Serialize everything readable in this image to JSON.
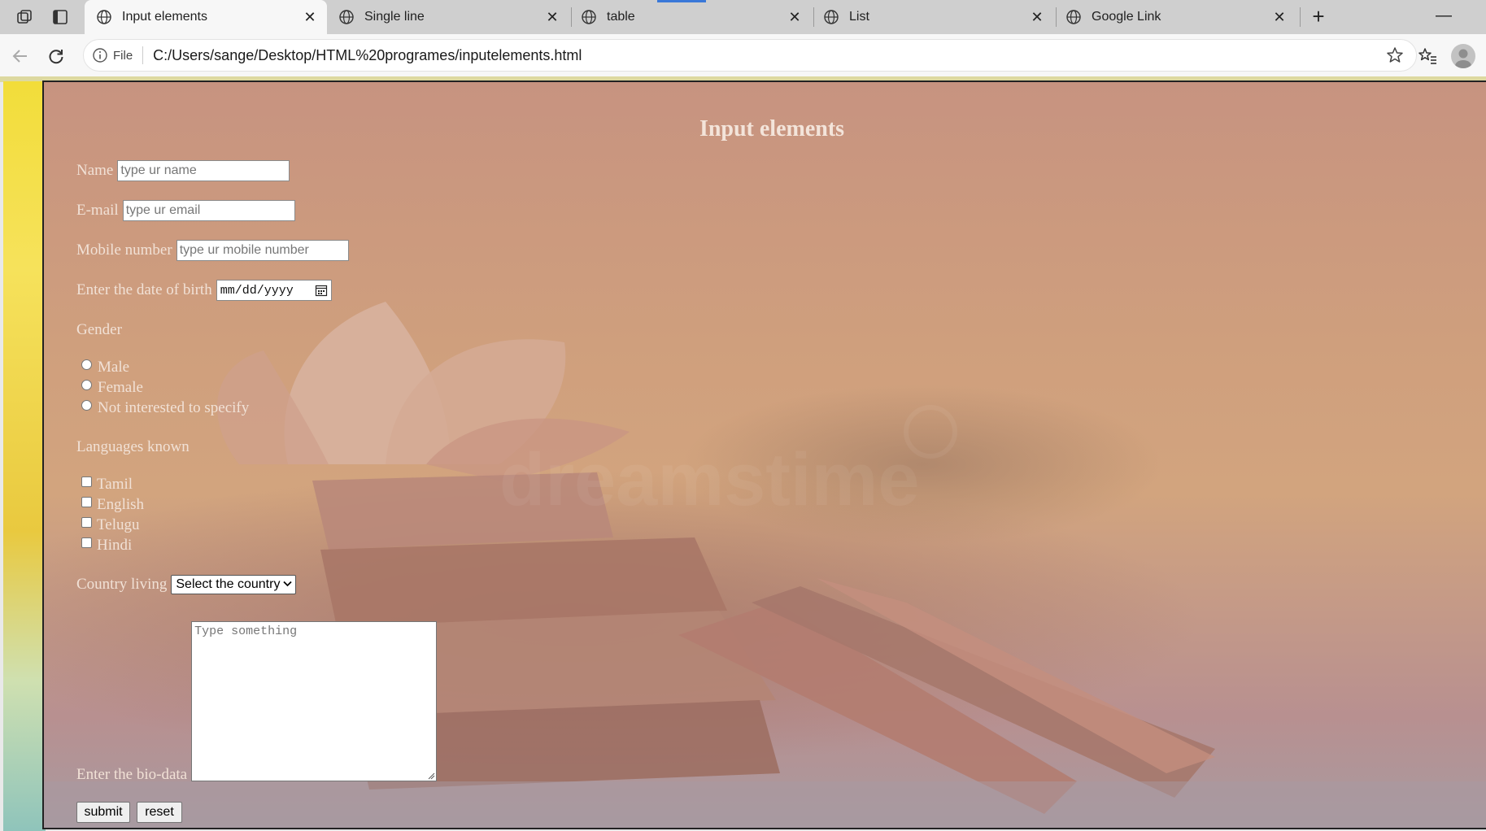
{
  "tabs": [
    {
      "title": "Input elements",
      "active": true
    },
    {
      "title": "Single line",
      "active": false
    },
    {
      "title": "table",
      "active": false
    },
    {
      "title": "List",
      "active": false
    },
    {
      "title": "Google Link",
      "active": false
    }
  ],
  "address_bar": {
    "scheme_label": "File",
    "url": "C:/Users/sange/Desktop/HTML%20programes/inputelements.html"
  },
  "page": {
    "heading": "Input elements",
    "name_label": "Name",
    "name_placeholder": "type ur name",
    "email_label": "E-mail",
    "email_placeholder": "type ur email",
    "mobile_label": "Mobile number",
    "mobile_placeholder": "type ur mobile number",
    "dob_label": "Enter the date of birth",
    "dob_placeholder": "mm/dd/yyyy",
    "gender_label": "Gender",
    "gender_options": [
      "Male",
      "Female",
      "Not interested to specify"
    ],
    "languages_label": "Languages known",
    "language_options": [
      "Tamil",
      "English",
      "Telugu",
      "Hindi"
    ],
    "country_label": "Country living",
    "country_selected": "Select the country",
    "bio_label": "Enter the bio-data",
    "bio_placeholder": "Type something",
    "submit_label": "submit",
    "reset_label": "reset"
  },
  "colors": {
    "page_tint": "#c99a82",
    "label_text": "#f1e1d6",
    "tab_active_bg": "#f7f7f7",
    "tab_strip_bg": "#cfcfcf",
    "load_indicator": "#3a78d8"
  },
  "icons": [
    "workspaces-icon",
    "vertical-tabs-icon",
    "globe-icon",
    "close-icon",
    "new-tab-icon",
    "minimize-icon",
    "back-icon",
    "refresh-icon",
    "info-icon",
    "star-icon",
    "favorites-icon",
    "profile-icon",
    "calendar-icon",
    "chevron-down-icon"
  ]
}
